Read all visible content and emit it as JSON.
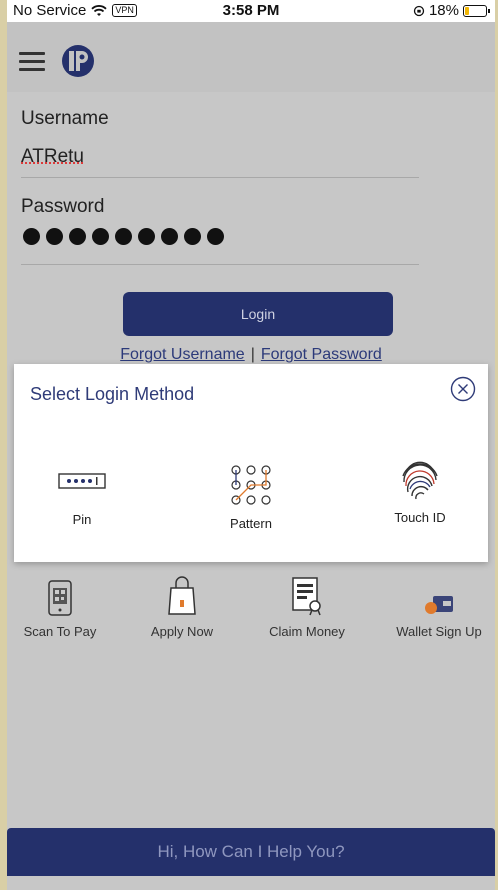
{
  "status_bar": {
    "carrier": "No Service",
    "vpn": "VPN",
    "time": "3:58 PM",
    "battery": "18%"
  },
  "login_form": {
    "username_label": "Username",
    "username_value": "ATRetu",
    "password_label": "Password",
    "login_button": "Login",
    "forgot_username": "Forgot Username",
    "separator": "|",
    "forgot_password": "Forgot Password"
  },
  "modal": {
    "title": "Select Login Method",
    "options": [
      {
        "label": "Pin",
        "icon": "pin-icon"
      },
      {
        "label": "Pattern",
        "icon": "pattern-icon"
      },
      {
        "label": "Touch ID",
        "icon": "fingerprint-icon"
      }
    ]
  },
  "quick_actions": [
    {
      "label": "Scan To Pay",
      "icon": "qr-phone-icon"
    },
    {
      "label": "Apply Now",
      "icon": "shopping-bag-icon"
    },
    {
      "label": "Claim Money",
      "icon": "certificate-icon"
    },
    {
      "label": "Wallet Sign Up",
      "icon": "wallet-icon"
    }
  ],
  "chat": {
    "prompt": "Hi, How Can I Help You?"
  },
  "colors": {
    "brand_navy": "#24306b",
    "overlay_gray": "#c2c2c2",
    "title_blue": "#2f3b78"
  }
}
